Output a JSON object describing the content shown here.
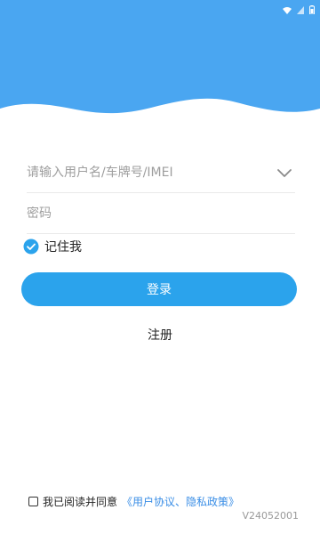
{
  "colors": {
    "header_blue": "#4aa6f1",
    "primary": "#2ba3ec",
    "link": "#3a8ee6"
  },
  "status_bar": {
    "icons": [
      "wifi-icon",
      "signal-icon",
      "battery-icon"
    ]
  },
  "login": {
    "username_placeholder": "请输入用户名/车牌号/IMEI",
    "password_placeholder": "密码",
    "remember_label": "记住我",
    "remember_checked": true,
    "login_button": "登录",
    "register_link": "注册"
  },
  "agreement": {
    "checked": false,
    "text": "我已阅读并同意",
    "link": "《用户协议、隐私政策》"
  },
  "version": "V24052001"
}
